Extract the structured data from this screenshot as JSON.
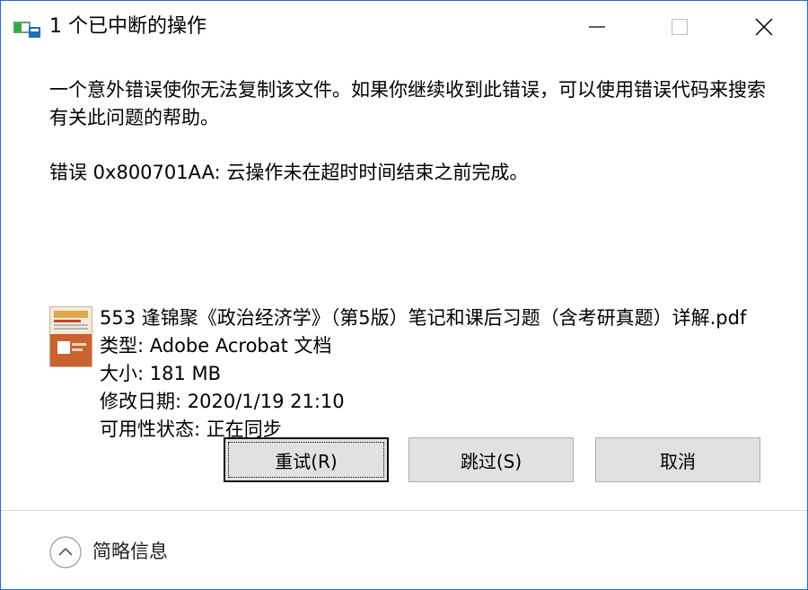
{
  "window": {
    "title": "1 个已中断的操作",
    "icons": {
      "app": "copy-progress-icon",
      "minimize": "minimize-icon",
      "maximize": "maximize-icon",
      "close": "close-icon"
    }
  },
  "message": "一个意外错误使你无法复制该文件。如果你继续收到此错误，可以使用错误代码来搜索有关此问题的帮助。",
  "error": "错误 0x800701AA: 云操作未在超时时间结束之前完成。",
  "file": {
    "name": "553 逢锦聚《政治经济学》（第5版）笔记和课后习题（含考研真题）详解.pdf",
    "type": "类型: Adobe Acrobat 文档",
    "size": "大小: 181 MB",
    "modified": "修改日期: 2020/1/19 21:10",
    "availability": "可用性状态: 正在同步",
    "thumbnail_icon": "pdf-thumbnail-icon"
  },
  "buttons": {
    "retry": "重试(R)",
    "skip": "跳过(S)",
    "cancel": "取消"
  },
  "footer": {
    "label": "简略信息",
    "icon": "chevron-up-icon"
  },
  "colors": {
    "window_border": "#1f6ebf",
    "button_bg": "#e1e1e1",
    "button_border": "#adadad"
  }
}
